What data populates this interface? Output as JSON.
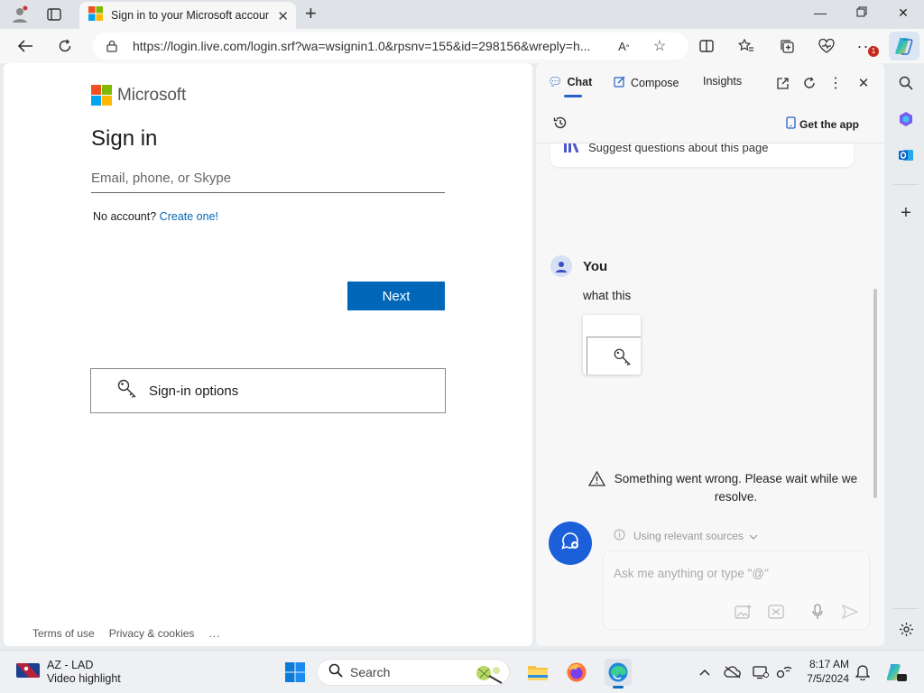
{
  "browser": {
    "tab_title": "Sign in to your Microsoft account",
    "url": "https://login.live.com/login.srf?wa=wsignin1.0&rpsnv=155&id=298156&wreply=h...",
    "notification_badge": "1"
  },
  "signin_page": {
    "brand": "Microsoft",
    "title": "Sign in",
    "email_placeholder": "Email, phone, or Skype",
    "no_account_text": "No account?",
    "create_link": "Create one!",
    "next_button": "Next",
    "signin_options": "Sign-in options",
    "footer_terms": "Terms of use",
    "footer_privacy": "Privacy & cookies",
    "footer_more": "..."
  },
  "copilot": {
    "tabs": [
      {
        "label": "Chat",
        "active": true
      },
      {
        "label": "Compose",
        "active": false
      },
      {
        "label": "Insights",
        "active": false
      }
    ],
    "get_app": "Get the app",
    "suggest": "Suggest questions about this page",
    "user_name": "You",
    "user_message": "what this",
    "error_message": "Something went wrong. Please wait while we resolve.",
    "relevant_sources": "Using relevant sources",
    "input_placeholder": "Ask me anything or type \"@\""
  },
  "taskbar": {
    "weather_title": "AZ - LAD",
    "weather_sub": "Video highlight",
    "search_label": "Search",
    "time": "8:17 AM",
    "date": "7/5/2024"
  },
  "colors": {
    "ms_blue": "#0067b8",
    "copilot_blue": "#1b5fd9"
  }
}
